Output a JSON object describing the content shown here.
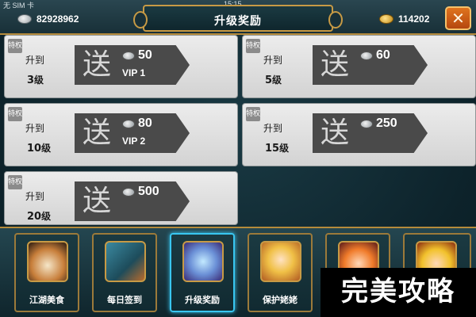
{
  "status_bar": {
    "carrier": "无 SIM 卡",
    "time": "15:15"
  },
  "header": {
    "title": "升级奖励",
    "silver_amount": "82928962",
    "gold_amount": "114202",
    "close_glyph": "✕"
  },
  "rewards": [
    {
      "tag": "特权",
      "prefix": "升到",
      "level": "3",
      "unit": "级",
      "gift": "送",
      "amount": "50",
      "vip": "VIP 1"
    },
    {
      "tag": "特权",
      "prefix": "升到",
      "level": "5",
      "unit": "级",
      "gift": "送",
      "amount": "60",
      "vip": ""
    },
    {
      "tag": "特权",
      "prefix": "升到",
      "level": "10",
      "unit": "级",
      "gift": "送",
      "amount": "80",
      "vip": "VIP 2"
    },
    {
      "tag": "特权",
      "prefix": "升到",
      "level": "15",
      "unit": "级",
      "gift": "送",
      "amount": "250",
      "vip": ""
    },
    {
      "tag": "特权",
      "prefix": "升到",
      "level": "20",
      "unit": "级",
      "gift": "送",
      "amount": "500",
      "vip": ""
    }
  ],
  "menu": [
    {
      "label": "江湖美食",
      "icon": "ramen-bowl-icon"
    },
    {
      "label": "每日签到",
      "icon": "scroll-bundle-icon"
    },
    {
      "label": "升级奖励",
      "icon": "treasure-chest-icon",
      "active": true
    },
    {
      "label": "保护姥姥",
      "icon": "blonde-girl-portrait-icon"
    },
    {
      "label": "",
      "icon": "orange-hair-hero-portrait-icon"
    },
    {
      "label": "",
      "icon": "blonde-hero-portrait-icon"
    }
  ],
  "watermark": "完美攻略",
  "colors": {
    "frame_gold": "#c79a45",
    "active_outline": "#39c6f0",
    "card_bg": "#e0e0e0",
    "ribbon": "#4a4a4a",
    "close_button": "#d8691b"
  }
}
